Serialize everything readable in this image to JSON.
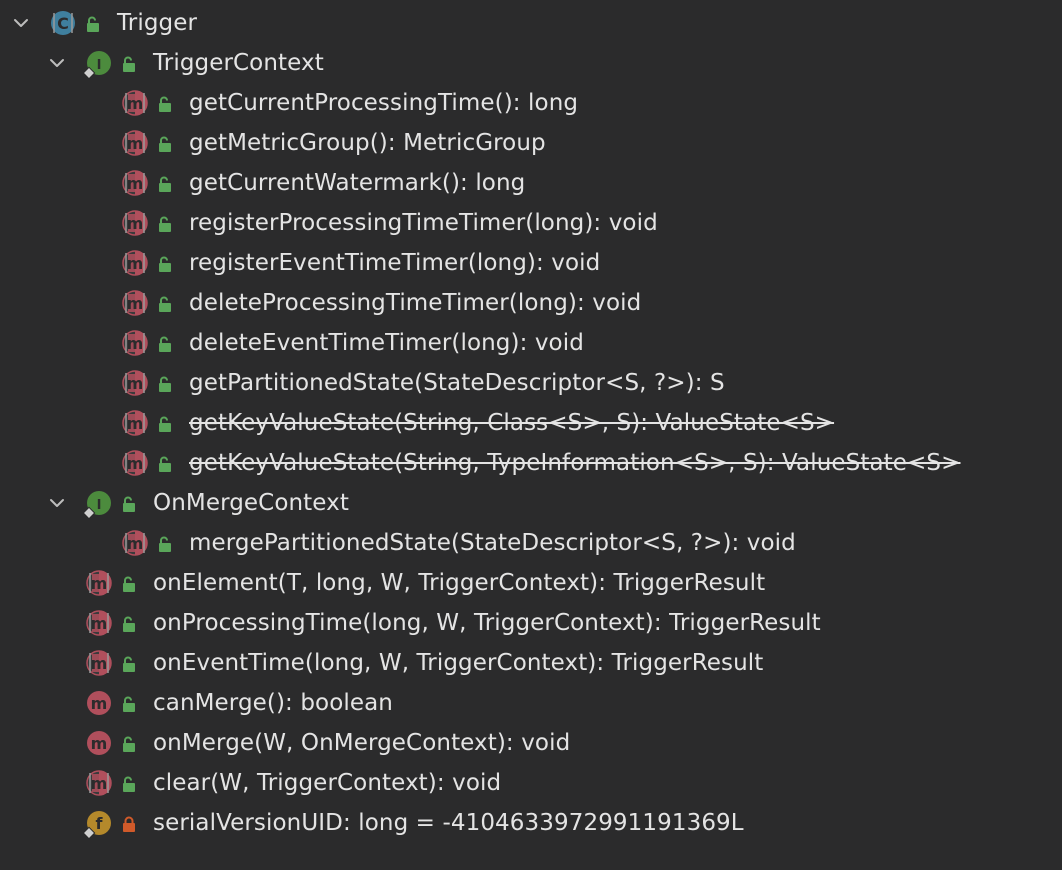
{
  "tree": {
    "root": {
      "label": "Trigger",
      "kind": "class",
      "expanded": true,
      "visibility": "public"
    },
    "items": [
      {
        "id": "trigger-context",
        "label": "TriggerContext",
        "kind": "interface",
        "depth": 1,
        "expandable": true,
        "expanded": true,
        "visibility": "public",
        "deprecated": false,
        "overrides": false
      },
      {
        "id": "get-current-processing-time",
        "label": "getCurrentProcessingTime(): long",
        "kind": "abstract-method",
        "depth": 2,
        "expandable": false,
        "visibility": "public",
        "deprecated": false,
        "overrides": false
      },
      {
        "id": "get-metric-group",
        "label": "getMetricGroup(): MetricGroup",
        "kind": "abstract-method",
        "depth": 2,
        "expandable": false,
        "visibility": "public",
        "deprecated": false,
        "overrides": false
      },
      {
        "id": "get-current-watermark",
        "label": "getCurrentWatermark(): long",
        "kind": "abstract-method",
        "depth": 2,
        "expandable": false,
        "visibility": "public",
        "deprecated": false,
        "overrides": false
      },
      {
        "id": "register-processing-time-timer",
        "label": "registerProcessingTimeTimer(long): void",
        "kind": "abstract-method",
        "depth": 2,
        "expandable": false,
        "visibility": "public",
        "deprecated": false,
        "overrides": false
      },
      {
        "id": "register-event-time-timer",
        "label": "registerEventTimeTimer(long): void",
        "kind": "abstract-method",
        "depth": 2,
        "expandable": false,
        "visibility": "public",
        "deprecated": false,
        "overrides": false
      },
      {
        "id": "delete-processing-time-timer",
        "label": "deleteProcessingTimeTimer(long): void",
        "kind": "abstract-method",
        "depth": 2,
        "expandable": false,
        "visibility": "public",
        "deprecated": false,
        "overrides": false
      },
      {
        "id": "delete-event-time-timer",
        "label": "deleteEventTimeTimer(long): void",
        "kind": "abstract-method",
        "depth": 2,
        "expandable": false,
        "visibility": "public",
        "deprecated": false,
        "overrides": false
      },
      {
        "id": "get-partitioned-state",
        "label": "getPartitionedState(StateDescriptor<S, ?>): S",
        "kind": "abstract-method",
        "depth": 2,
        "expandable": false,
        "visibility": "public",
        "deprecated": false,
        "overrides": false
      },
      {
        "id": "get-key-value-state-class",
        "label": "getKeyValueState(String, Class<S>, S): ValueState<S>",
        "kind": "abstract-method",
        "depth": 2,
        "expandable": false,
        "visibility": "public",
        "deprecated": true,
        "overrides": false
      },
      {
        "id": "get-key-value-state-typeinfo",
        "label": "getKeyValueState(String, TypeInformation<S>, S): ValueState<S>",
        "kind": "abstract-method",
        "depth": 2,
        "expandable": false,
        "visibility": "public",
        "deprecated": true,
        "overrides": false
      },
      {
        "id": "on-merge-context",
        "label": "OnMergeContext",
        "kind": "interface",
        "depth": 1,
        "expandable": true,
        "expanded": true,
        "visibility": "public",
        "deprecated": false,
        "overrides": false
      },
      {
        "id": "merge-partitioned-state",
        "label": "mergePartitionedState(StateDescriptor<S, ?>): void",
        "kind": "abstract-method",
        "depth": 2,
        "expandable": false,
        "visibility": "public",
        "deprecated": false,
        "overrides": false
      },
      {
        "id": "on-element",
        "label": "onElement(T, long, W, TriggerContext): TriggerResult",
        "kind": "abstract-method",
        "depth": 1,
        "expandable": false,
        "visibility": "public",
        "deprecated": false,
        "overrides": false
      },
      {
        "id": "on-processing-time",
        "label": "onProcessingTime(long, W, TriggerContext): TriggerResult",
        "kind": "abstract-method",
        "depth": 1,
        "expandable": false,
        "visibility": "public",
        "deprecated": false,
        "overrides": false
      },
      {
        "id": "on-event-time",
        "label": "onEventTime(long, W, TriggerContext): TriggerResult",
        "kind": "abstract-method",
        "depth": 1,
        "expandable": false,
        "visibility": "public",
        "deprecated": false,
        "overrides": false
      },
      {
        "id": "can-merge",
        "label": "canMerge(): boolean",
        "kind": "method",
        "depth": 1,
        "expandable": false,
        "visibility": "public",
        "deprecated": false,
        "overrides": false
      },
      {
        "id": "on-merge",
        "label": "onMerge(W, OnMergeContext): void",
        "kind": "method",
        "depth": 1,
        "expandable": false,
        "visibility": "public",
        "deprecated": false,
        "overrides": false
      },
      {
        "id": "clear",
        "label": "clear(W, TriggerContext): void",
        "kind": "abstract-method",
        "depth": 1,
        "expandable": false,
        "visibility": "public",
        "deprecated": false,
        "overrides": false
      },
      {
        "id": "serial-version-uid",
        "label": "serialVersionUID: long = -4104633972991191369L",
        "kind": "field",
        "depth": 1,
        "expandable": false,
        "visibility": "private",
        "deprecated": false,
        "overrides": false
      }
    ]
  },
  "icons": {
    "class": {
      "name": "class-icon",
      "letter": "C",
      "color": "#3f7f9e"
    },
    "interface": {
      "name": "interface-icon",
      "letter": "I",
      "color": "#4c8b3d"
    },
    "method": {
      "name": "method-icon",
      "letter": "m",
      "color": "#b04f5c"
    },
    "abstract-method": {
      "name": "abstract-method-icon",
      "letter": "m",
      "color": "#b04f5c"
    },
    "field": {
      "name": "field-icon",
      "letter": "f",
      "color": "#b4892b"
    },
    "public": {
      "name": "public-lock-open-icon",
      "color": "#5aa65a"
    },
    "private": {
      "name": "private-lock-icon",
      "color": "#d05a2a"
    },
    "chevron": {
      "name": "chevron-down-icon",
      "color": "#bdbdbd"
    }
  },
  "theme": {
    "background": "#2b2b2c",
    "text": "#e4e4e4"
  }
}
